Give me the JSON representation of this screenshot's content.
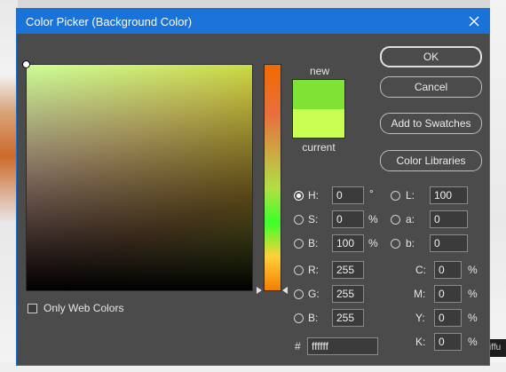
{
  "dialog": {
    "title": "Color Picker (Background Color)"
  },
  "preview": {
    "new_label": "new",
    "current_label": "current",
    "new_color": "#7fe234",
    "current_color": "#c8ff50"
  },
  "buttons": {
    "ok": "OK",
    "cancel": "Cancel",
    "add_to_swatches": "Add to Swatches",
    "color_libraries": "Color Libraries"
  },
  "hsb": {
    "h_label": "H:",
    "h_value": "0",
    "h_unit": "°",
    "s_label": "S:",
    "s_value": "0",
    "s_unit": "%",
    "b_label": "B:",
    "b_value": "100",
    "b_unit": "%",
    "selected": "H"
  },
  "lab": {
    "l_label": "L:",
    "l_value": "100",
    "a_label": "a:",
    "a_value": "0",
    "b_label": "b:",
    "b_value": "0"
  },
  "rgb": {
    "r_label": "R:",
    "r_value": "255",
    "g_label": "G:",
    "g_value": "255",
    "b_label": "B:",
    "b_value": "255"
  },
  "cmyk": {
    "c_label": "C:",
    "c_value": "0",
    "m_label": "M:",
    "m_value": "0",
    "y_label": "Y:",
    "y_value": "0",
    "k_label": "K:",
    "k_value": "0",
    "unit": "%"
  },
  "hex": {
    "label": "#",
    "value": "ffffff"
  },
  "only_web_colors": {
    "label": "Only Web Colors",
    "checked": false
  },
  "background_fragment": {
    "text": "iffu"
  },
  "colors": {
    "titlebar": "#1a73d9",
    "dialog_bg": "#4b4b4b"
  }
}
